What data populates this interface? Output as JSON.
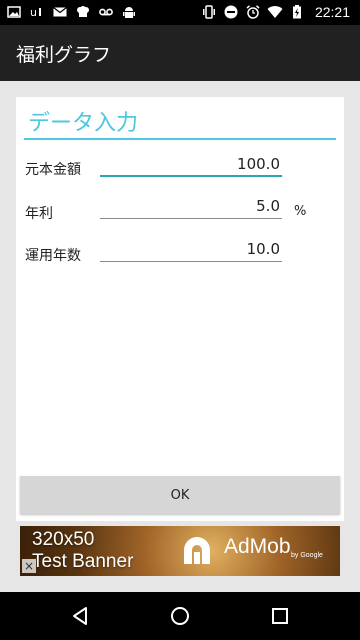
{
  "status_bar": {
    "time": "22:21",
    "left_icons": [
      "image-icon",
      "usb-icon",
      "mail-icon",
      "chef-icon",
      "voicemail-icon",
      "android-icon"
    ],
    "right_icons": [
      "vibrate-icon",
      "do-not-disturb-icon",
      "alarm-icon",
      "wifi-icon",
      "battery-charging-icon"
    ]
  },
  "app_bar": {
    "title": "福利グラフ"
  },
  "form": {
    "section_title": "データ入力",
    "principal": {
      "label": "元本金額",
      "value": "100.0"
    },
    "rate": {
      "label": "年利",
      "value": "5.0",
      "unit": "%"
    },
    "years": {
      "label": "運用年数",
      "value": "10.0"
    }
  },
  "ok_button": {
    "label": "OK"
  },
  "ad": {
    "line1": "320x50",
    "line2": "Test Banner",
    "brand": "AdMob",
    "brand_sub": "by Google",
    "close": "×"
  },
  "nav": {
    "icons": [
      "back-icon",
      "home-icon",
      "recents-icon"
    ]
  },
  "colors": {
    "accent": "#4dc8dc",
    "focus_line": "#28a6b3",
    "app_bar": "#212121",
    "background": "#e6e6e6"
  }
}
